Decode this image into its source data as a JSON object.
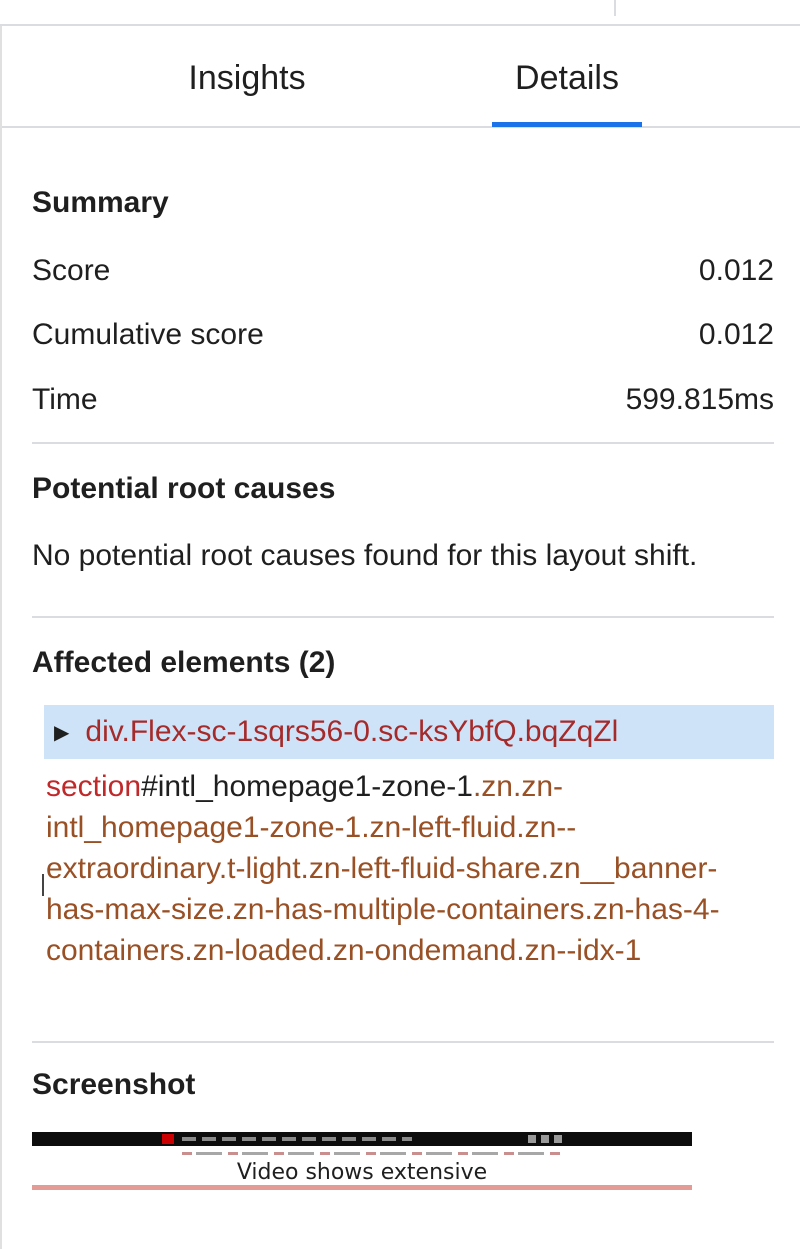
{
  "tabs": [
    {
      "label": "Insights",
      "active": false
    },
    {
      "label": "Details",
      "active": true
    }
  ],
  "summary": {
    "title": "Summary",
    "rows": [
      {
        "label": "Score",
        "value": "0.012"
      },
      {
        "label": "Cumulative score",
        "value": "0.012"
      },
      {
        "label": "Time",
        "value": "599.815ms"
      }
    ]
  },
  "root_causes": {
    "title": "Potential root causes",
    "text": "No potential root causes found for this layout shift."
  },
  "affected": {
    "title": "Affected elements (2)",
    "node_tag": "div.Flex-sc-1sqrs56-0.sc-ksYbfQ.bqZqZl",
    "selector_tag": "section",
    "selector_id": "#intl_homepage1-zone-1",
    "selector_classes": ".zn.zn-intl_homepage1-zone-1.zn-left-fluid.zn--extraordinary.t-light.zn-left-fluid-share.zn__banner-has-max-size.zn-has-multiple-containers.zn-has-4-containers.zn-loaded.zn-ondemand.zn--idx-1"
  },
  "screenshot": {
    "title": "Screenshot",
    "headline": "Video shows extensive"
  },
  "colors": {
    "accent": "#1a73e8",
    "node_highlight": "#cfe3f8",
    "tag_red": "#c0282a",
    "class_brown": "#995025"
  }
}
